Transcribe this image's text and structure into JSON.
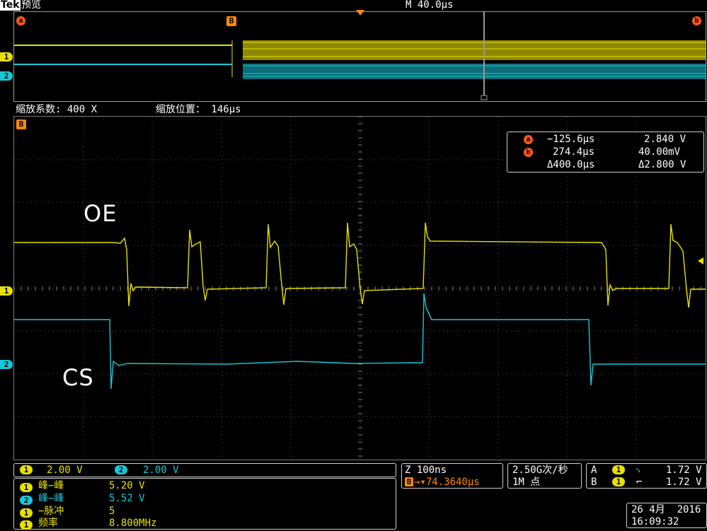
{
  "header": {
    "brand": "Tek",
    "mode": "预览",
    "timebase": "M 40.0μs"
  },
  "overview": {
    "cursor_a": "a",
    "cursor_b": "b",
    "marker_B": "B",
    "ch1_label": "1",
    "ch2_label": "2"
  },
  "zoom_bar": {
    "factor_label": "缩放系数: 400 X",
    "position_label": "缩放位置： 146μs"
  },
  "main": {
    "marker_B": "B",
    "trace_labels": {
      "oe": "OE",
      "cs": "CS"
    },
    "ch1_marker": "1",
    "ch2_marker": "2"
  },
  "cursor_readout": {
    "a_label": "a",
    "a_time": "−125.6μs",
    "a_value": "2.840 V",
    "b_label": "b",
    "b_time": "274.4μs",
    "b_value": "40.00mV",
    "delta_time": "Δ400.0μs",
    "delta_value": "Δ2.800 V"
  },
  "bottom": {
    "ch1_chip": "1",
    "ch1_scale": "2.00 V",
    "ch2_chip": "2",
    "ch2_scale": "2.00 V",
    "measurements": [
      {
        "chip": "1",
        "name": "峰−峰",
        "value": "5.20 V",
        "color": "y"
      },
      {
        "chip": "2",
        "name": "峰−峰",
        "value": "5.52 V",
        "color": "c"
      },
      {
        "chip": "1",
        "name": "−脉冲",
        "value": "5",
        "color": "y"
      },
      {
        "chip": "1",
        "name": "频率",
        "value": "8.800MHz",
        "color": "y"
      }
    ],
    "zoom": "Z 100ns",
    "zoom_delay_prefix": "B",
    "zoom_delay": "→▾74.3640μs",
    "sample_rate": "2.50G次/秒",
    "record_length": "1M 点",
    "trig_a_label": "A",
    "trig_a_chip": "1",
    "trig_a_slope": "⌍",
    "trig_a_level": "1.72 V",
    "trig_b_label": "B",
    "trig_b_chip": "1",
    "trig_b_slope": "⌐",
    "trig_b_level": "1.72 V",
    "date": "26 4月  2016",
    "time": "16:09:32"
  },
  "colors": {
    "ch1": "#e8e000",
    "ch2": "#18c8d8",
    "cursor": "#ff5a1a",
    "grid": "#5a5a5a"
  }
}
